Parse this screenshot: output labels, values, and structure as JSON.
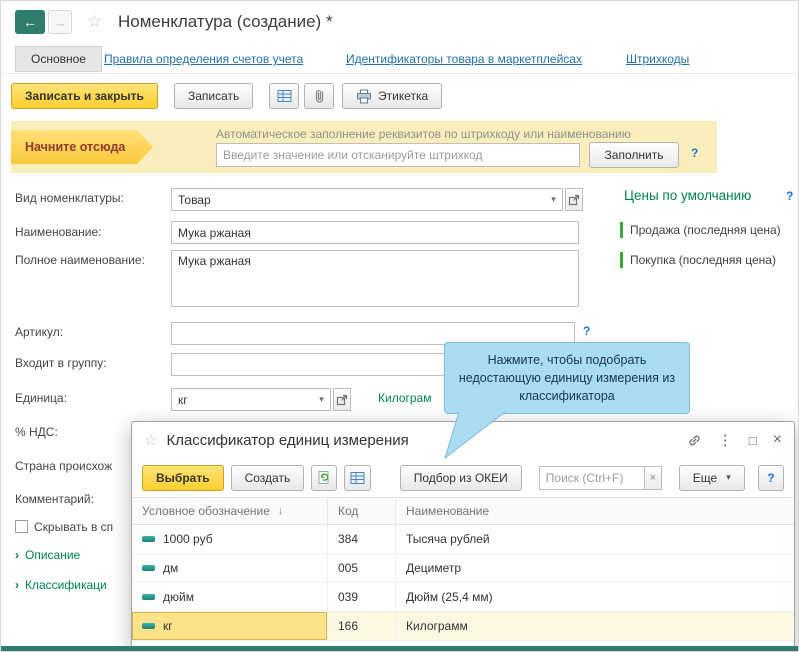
{
  "colors": {
    "accent-yellow": "#fdd02f",
    "accent-yellow-border": "#c9a227",
    "panel-yellow": "#faefbc",
    "teal": "#2e7d6e",
    "link-blue": "#2470a8",
    "green": "#008055",
    "green-bar": "#3da63d",
    "callout-bg": "#aadcf2",
    "callout-border": "#7cbcdc",
    "selected-cell": "#fbe38a",
    "red-text": "#8f3b2d"
  },
  "icons": {
    "back-icon": "←",
    "forward-icon": "→",
    "star-icon": "☆",
    "caret-down-icon": "▾",
    "more-dots-icon": "⋮",
    "maximize-icon": "□",
    "close-icon": "×",
    "clear-icon": "×",
    "sort-down-icon": "↓",
    "expander-icon": "›",
    "help-icon": "?"
  },
  "header": {
    "title": "Номенклатура (создание) *"
  },
  "tabs": {
    "active": "Основное",
    "links": [
      "Правила определения счетов учета",
      "Идентификаторы товара в маркетплейсах",
      "Штрихкоды"
    ]
  },
  "toolbar": {
    "save_close": "Записать и закрыть",
    "save": "Записать",
    "label_button": "Этикетка"
  },
  "autofill": {
    "arrow_label": "Начните отсюда",
    "hint": "Автоматическое заполнение реквизитов по штрихкоду или наименованию",
    "placeholder": "Введите значение или отсканируйте штрихкод",
    "fill_button": "Заполнить",
    "help": "?"
  },
  "form": {
    "kind_label": "Вид номенклатуры:",
    "kind_value": "Товар",
    "name_label": "Наименование:",
    "name_value": "Мука ржаная",
    "full_name_label": "Полное наименование:",
    "full_name_value": "Мука ржаная",
    "sku_label": "Артикул:",
    "sku_help": "?",
    "group_label": "Входит в группу:",
    "unit_label": "Единица:",
    "unit_value": "кг",
    "unit_name": "Килограм",
    "vat_label": "% НДС:",
    "country_label": "Страна происхож",
    "comment_label": "Комментарий:",
    "hide_label": "Скрывать в сп",
    "description_link": "Описание",
    "classification_link": "Классификаци"
  },
  "prices": {
    "title": "Цены по умолчанию",
    "help": "?",
    "items": [
      "Продажа (последняя цена)",
      "Покупка (последняя цена)"
    ]
  },
  "callout": {
    "text": "Нажмите, чтобы подобрать недостающую единицу измерения из классификатора"
  },
  "dialog": {
    "title": "Классификатор единиц измерения",
    "select_button": "Выбрать",
    "create_button": "Создать",
    "okei_button": "Подбор из ОКЕИ",
    "search_placeholder": "Поиск (Ctrl+F)",
    "more_button": "Еще",
    "help_button": "?",
    "table": {
      "columns": [
        "Условное обозначение",
        "Код",
        "Наименование"
      ],
      "sort_indicator": "↓",
      "rows": [
        {
          "symbol": "1000 руб",
          "code": "384",
          "name": "Тысяча рублей"
        },
        {
          "symbol": "дм",
          "code": "005",
          "name": "Дециметр"
        },
        {
          "symbol": "дюйм",
          "code": "039",
          "name": "Дюйм (25,4 мм)"
        },
        {
          "symbol": "кг",
          "code": "166",
          "name": "Килограмм"
        }
      ],
      "selected_index": 3
    }
  }
}
